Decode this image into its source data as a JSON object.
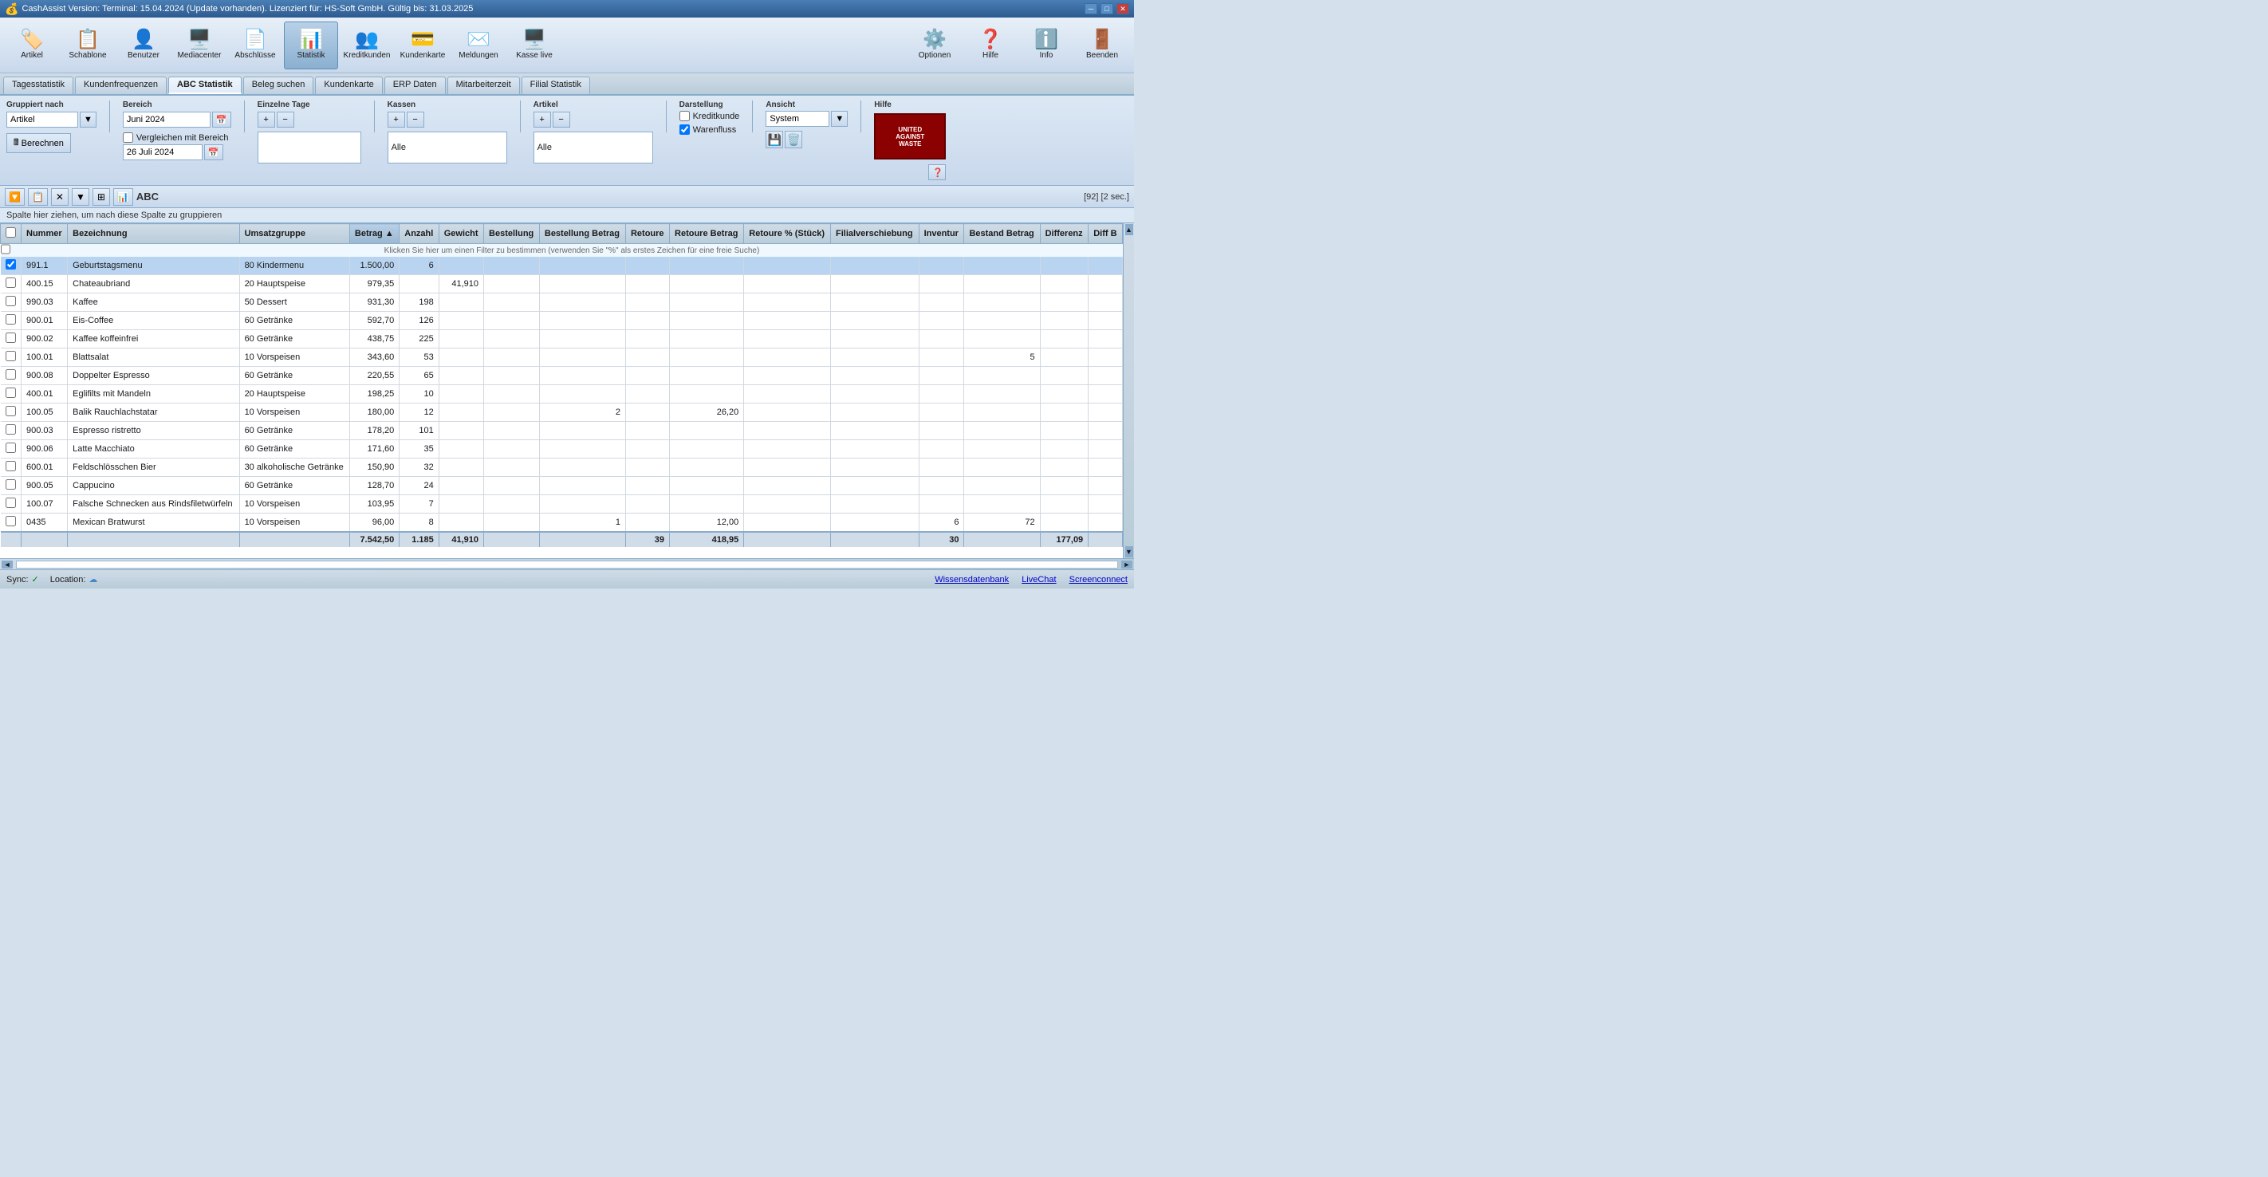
{
  "titlebar": {
    "text": "CashAssist  Version: Terminal: 15.04.2024 (Update vorhanden).  Lizenziert für: HS-Soft GmbH.  Gültig bis: 31.03.2025",
    "minimize": "─",
    "maximize": "□",
    "close": "✕"
  },
  "toolbar": {
    "items": [
      {
        "id": "artikel",
        "icon": "🏷️",
        "label": "Artikel"
      },
      {
        "id": "schablone",
        "icon": "📋",
        "label": "Schablone"
      },
      {
        "id": "benutzer",
        "icon": "👤",
        "label": "Benutzer"
      },
      {
        "id": "mediacenter",
        "icon": "🖥️",
        "label": "Mediacenter"
      },
      {
        "id": "abschluesse",
        "icon": "📄",
        "label": "Abschlüsse"
      },
      {
        "id": "statistik",
        "icon": "📊",
        "label": "Statistik"
      },
      {
        "id": "kreditkunden",
        "icon": "👥",
        "label": "Kreditkunden"
      },
      {
        "id": "kundenkarte",
        "icon": "💳",
        "label": "Kundenkarte"
      },
      {
        "id": "meldungen",
        "icon": "✉️",
        "label": "Meldungen"
      },
      {
        "id": "kasse-live",
        "icon": "🖥️",
        "label": "Kasse live"
      },
      {
        "id": "optionen",
        "icon": "⚙️",
        "label": "Optionen"
      },
      {
        "id": "hilfe",
        "icon": "❓",
        "label": "Hilfe"
      },
      {
        "id": "info",
        "icon": "ℹ️",
        "label": "Info"
      },
      {
        "id": "beenden",
        "icon": "🚪",
        "label": "Beenden"
      }
    ]
  },
  "tabs": [
    {
      "id": "tagesstatistik",
      "label": "Tagesstatistik"
    },
    {
      "id": "kundenfrequenzen",
      "label": "Kundenfrequenzen"
    },
    {
      "id": "abc-statistik",
      "label": "ABC Statistik",
      "active": true
    },
    {
      "id": "beleg-suchen",
      "label": "Beleg suchen"
    },
    {
      "id": "kundenkarte",
      "label": "Kundenkarte"
    },
    {
      "id": "erp-daten",
      "label": "ERP Daten"
    },
    {
      "id": "mitarbeiterzeit",
      "label": "Mitarbeiterzeit"
    },
    {
      "id": "filial-statistik",
      "label": "Filial Statistik"
    }
  ],
  "controls": {
    "gruppiert_nach_label": "Gruppiert nach",
    "gruppiert_nach_value": "Artikel",
    "bereich_label": "Bereich",
    "bereich_value": "Juni 2024",
    "einzelne_tage_label": "Einzelne Tage",
    "kassen_label": "Kassen",
    "kassen_value": "Alle",
    "artikel_label": "Artikel",
    "artikel_value": "Alle",
    "berechnen_label": "Berechnen",
    "vergleichen_mit_bereich": "Vergleichen mit Bereich",
    "vergleich_date": "26 Juli 2024",
    "darstellung_label": "Darstellung",
    "kreditkunde_label": "Kreditkunde",
    "warenfluss_label": "Warenfluss",
    "warenfluss_checked": true,
    "ansicht_label": "Ansicht",
    "ansicht_value": "System",
    "hilfe_label": "Hilfe"
  },
  "toolbar2": {
    "record_count": "[92] [2 sec.]",
    "abc_label": "ABC"
  },
  "table": {
    "drag_hint": "Spalte hier ziehen, um nach diese Spalte zu gruppieren",
    "filter_hint": "Klicken Sie hier um einen Filter zu bestimmen (verwenden Sie \"%\" als erstes Zeichen für eine freie Suche)",
    "columns": [
      {
        "id": "nummer",
        "label": "Nummer",
        "sortable": true
      },
      {
        "id": "bezeichnung",
        "label": "Bezeichnung",
        "sortable": true
      },
      {
        "id": "umsatzgruppe",
        "label": "Umsatzgruppe",
        "sortable": true
      },
      {
        "id": "betrag",
        "label": "Betrag",
        "sortable": true,
        "sorted": true
      },
      {
        "id": "anzahl",
        "label": "Anzahl",
        "sortable": true
      },
      {
        "id": "gewicht",
        "label": "Gewicht",
        "sortable": true
      },
      {
        "id": "bestellung",
        "label": "Bestellung",
        "sortable": true
      },
      {
        "id": "bestellung-betrag",
        "label": "Bestellung Betrag",
        "sortable": true
      },
      {
        "id": "retoure",
        "label": "Retoure",
        "sortable": true
      },
      {
        "id": "retoure-betrag",
        "label": "Retoure Betrag",
        "sortable": true
      },
      {
        "id": "retoure-stueck",
        "label": "Retoure % (Stück)",
        "sortable": true
      },
      {
        "id": "filialverschie-bung",
        "label": "Filialverschie bung",
        "sortable": true
      },
      {
        "id": "inventur",
        "label": "Inventur",
        "sortable": true
      },
      {
        "id": "bestand-betrag",
        "label": "Bestand Betrag",
        "sortable": true
      },
      {
        "id": "differenz",
        "label": "Differenz",
        "sortable": true
      },
      {
        "id": "diff-b",
        "label": "Diff B",
        "sortable": true
      }
    ],
    "rows": [
      {
        "nummer": "991.1",
        "bezeichnung": "Geburtstagsmenu",
        "umsatzgruppe": "80 Kindermenu",
        "betrag": "1.500,00",
        "anzahl": "6",
        "gewicht": "",
        "bestellung": "",
        "bestellung_betrag": "",
        "retoure": "",
        "retoure_betrag": "",
        "retoure_stueck": "",
        "filialverschie": "",
        "inventur": "",
        "bestand_betrag": "",
        "differenz": "",
        "diff_b": "",
        "selected": true
      },
      {
        "nummer": "400.15",
        "bezeichnung": "Chateaubriand",
        "umsatzgruppe": "20 Hauptspeise",
        "betrag": "979,35",
        "anzahl": "",
        "gewicht": "41,910",
        "bestellung": "",
        "bestellung_betrag": "",
        "retoure": "",
        "retoure_betrag": "",
        "retoure_stueck": "",
        "filialverschie": "",
        "inventur": "",
        "bestand_betrag": "",
        "differenz": "",
        "diff_b": ""
      },
      {
        "nummer": "990.03",
        "bezeichnung": "Kaffee",
        "umsatzgruppe": "50 Dessert",
        "betrag": "931,30",
        "anzahl": "198",
        "gewicht": "",
        "bestellung": "",
        "bestellung_betrag": "",
        "retoure": "",
        "retoure_betrag": "",
        "retoure_stueck": "",
        "filialverschie": "",
        "inventur": "",
        "bestand_betrag": "",
        "differenz": "",
        "diff_b": ""
      },
      {
        "nummer": "900.01",
        "bezeichnung": "Eis-Coffee",
        "umsatzgruppe": "60 Getränke",
        "betrag": "592,70",
        "anzahl": "126",
        "gewicht": "",
        "bestellung": "",
        "bestellung_betrag": "",
        "retoure": "",
        "retoure_betrag": "",
        "retoure_stueck": "",
        "filialverschie": "",
        "inventur": "",
        "bestand_betrag": "",
        "differenz": "",
        "diff_b": ""
      },
      {
        "nummer": "900.02",
        "bezeichnung": "Kaffee koffeinfrei",
        "umsatzgruppe": "60 Getränke",
        "betrag": "438,75",
        "anzahl": "225",
        "gewicht": "",
        "bestellung": "",
        "bestellung_betrag": "",
        "retoure": "",
        "retoure_betrag": "",
        "retoure_stueck": "",
        "filialverschie": "",
        "inventur": "",
        "bestand_betrag": "",
        "differenz": "",
        "diff_b": ""
      },
      {
        "nummer": "100.01",
        "bezeichnung": "Blattsalat",
        "umsatzgruppe": "10 Vorspeisen",
        "betrag": "343,60",
        "anzahl": "53",
        "gewicht": "",
        "bestellung": "",
        "bestellung_betrag": "",
        "retoure": "",
        "retoure_betrag": "",
        "retoure_stueck": "",
        "filialverschie": "",
        "inventur": "",
        "bestand_betrag": "5",
        "differenz": "",
        "diff_b": ""
      },
      {
        "nummer": "900.08",
        "bezeichnung": "Doppelter Espresso",
        "umsatzgruppe": "60 Getränke",
        "betrag": "220,55",
        "anzahl": "65",
        "gewicht": "",
        "bestellung": "",
        "bestellung_betrag": "",
        "retoure": "",
        "retoure_betrag": "",
        "retoure_stueck": "",
        "filialverschie": "",
        "inventur": "",
        "bestand_betrag": "",
        "differenz": "",
        "diff_b": ""
      },
      {
        "nummer": "400.01",
        "bezeichnung": "Eglifilts mit Mandeln",
        "umsatzgruppe": "20 Hauptspeise",
        "betrag": "198,25",
        "anzahl": "10",
        "gewicht": "",
        "bestellung": "",
        "bestellung_betrag": "",
        "retoure": "",
        "retoure_betrag": "",
        "retoure_stueck": "",
        "filialverschie": "",
        "inventur": "",
        "bestand_betrag": "",
        "differenz": "",
        "diff_b": ""
      },
      {
        "nummer": "100.05",
        "bezeichnung": "Balik Rauchlachstatar",
        "umsatzgruppe": "10 Vorspeisen",
        "betrag": "180,00",
        "anzahl": "12",
        "gewicht": "",
        "bestellung": "",
        "bestellung_betrag": "2",
        "retoure": "",
        "retoure_betrag": "26,20",
        "retoure_stueck": "",
        "filialverschie": "",
        "inventur": "",
        "bestand_betrag": "",
        "differenz": "",
        "diff_b": ""
      },
      {
        "nummer": "900.03",
        "bezeichnung": "Espresso ristretto",
        "umsatzgruppe": "60 Getränke",
        "betrag": "178,20",
        "anzahl": "101",
        "gewicht": "",
        "bestellung": "",
        "bestellung_betrag": "",
        "retoure": "",
        "retoure_betrag": "",
        "retoure_stueck": "",
        "filialverschie": "",
        "inventur": "",
        "bestand_betrag": "",
        "differenz": "",
        "diff_b": ""
      },
      {
        "nummer": "900.06",
        "bezeichnung": "Latte Macchiato",
        "umsatzgruppe": "60 Getränke",
        "betrag": "171,60",
        "anzahl": "35",
        "gewicht": "",
        "bestellung": "",
        "bestellung_betrag": "",
        "retoure": "",
        "retoure_betrag": "",
        "retoure_stueck": "",
        "filialverschie": "",
        "inventur": "",
        "bestand_betrag": "",
        "differenz": "",
        "diff_b": ""
      },
      {
        "nummer": "600.01",
        "bezeichnung": "Feldschlösschen Bier",
        "umsatzgruppe": "30 alkoholische Getränke",
        "betrag": "150,90",
        "anzahl": "32",
        "gewicht": "",
        "bestellung": "",
        "bestellung_betrag": "",
        "retoure": "",
        "retoure_betrag": "",
        "retoure_stueck": "",
        "filialverschie": "",
        "inventur": "",
        "bestand_betrag": "",
        "differenz": "",
        "diff_b": ""
      },
      {
        "nummer": "900.05",
        "bezeichnung": "Cappucino",
        "umsatzgruppe": "60 Getränke",
        "betrag": "128,70",
        "anzahl": "24",
        "gewicht": "",
        "bestellung": "",
        "bestellung_betrag": "",
        "retoure": "",
        "retoure_betrag": "",
        "retoure_stueck": "",
        "filialverschie": "",
        "inventur": "",
        "bestand_betrag": "",
        "differenz": "",
        "diff_b": ""
      },
      {
        "nummer": "100.07",
        "bezeichnung": "Falsche Schnecken aus Rindsfiletwürfeln",
        "umsatzgruppe": "10 Vorspeisen",
        "betrag": "103,95",
        "anzahl": "7",
        "gewicht": "",
        "bestellung": "",
        "bestellung_betrag": "",
        "retoure": "",
        "retoure_betrag": "",
        "retoure_stueck": "",
        "filialverschie": "",
        "inventur": "",
        "bestand_betrag": "",
        "differenz": "",
        "diff_b": ""
      },
      {
        "nummer": "0435",
        "bezeichnung": "Mexican Bratwurst",
        "umsatzgruppe": "10 Vorspeisen",
        "betrag": "96,00",
        "anzahl": "8",
        "gewicht": "",
        "bestellung": "",
        "bestellung_betrag": "1",
        "retoure": "",
        "retoure_betrag": "12,00",
        "retoure_stueck": "",
        "filialverschie": "",
        "inventur": "6",
        "bestand_betrag": "72",
        "differenz": "",
        "diff_b": ""
      }
    ],
    "footer": {
      "betrag": "7.542,50",
      "anzahl": "1.185",
      "gewicht": "41,910",
      "retoure": "39",
      "retoure_betrag": "418,95",
      "inventur": "30",
      "differenz": "177,09"
    }
  },
  "statusbar": {
    "sync_label": "Sync:",
    "location_label": "Location:",
    "links": [
      {
        "id": "wissensdatenbank",
        "label": "Wissensdatenbank"
      },
      {
        "id": "livechat",
        "label": "LiveChat"
      },
      {
        "id": "screenconnect",
        "label": "Screenconnect"
      }
    ]
  }
}
